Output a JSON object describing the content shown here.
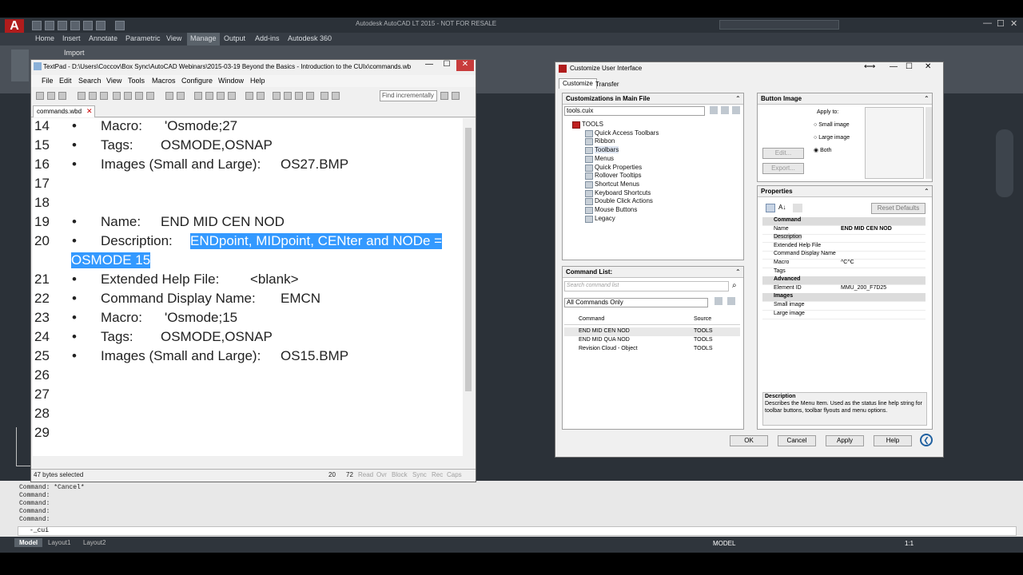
{
  "acad": {
    "title": "Autodesk AutoCAD LT 2015 - NOT FOR RESALE",
    "ribbon_tabs": [
      "Home",
      "Insert",
      "Annotate",
      "Parametric",
      "View",
      "Manage",
      "Output",
      "Add-ins",
      "Autodesk 360"
    ],
    "import_label": "Import",
    "cmd_lines": [
      "Command: *Cancel*",
      "Command:",
      "Command:",
      "Command:",
      "Command:"
    ],
    "cmd_input": "-_cui",
    "layout_tabs": [
      "Model",
      "Layout1",
      "Layout2"
    ],
    "status_model": "MODEL",
    "status_scale": "1:1"
  },
  "textpad": {
    "title": "TextPad - D:\\Users\\Coccov\\Box Sync\\AutoCAD Webinars\\2015-03-19 Beyond the Basics - Introduction to the CUIx\\commands.wbd",
    "menu": [
      "File",
      "Edit",
      "Search",
      "View",
      "Tools",
      "Macros",
      "Configure",
      "Window",
      "Help"
    ],
    "search_placeholder": "Find incrementally",
    "tab": "commands.wbd",
    "lines": [
      {
        "n": "14",
        "bullet": "•",
        "label": "Macro:",
        "value": "'Osmode;27"
      },
      {
        "n": "15",
        "bullet": "•",
        "label": "Tags:",
        "value": "OSMODE,OSNAP"
      },
      {
        "n": "16",
        "bullet": "•",
        "label": "Images (Small and Large):",
        "value": "OS27.BMP"
      },
      {
        "n": "17",
        "bullet": "",
        "label": "",
        "value": ""
      },
      {
        "n": "18",
        "bullet": "",
        "label": "",
        "value": ""
      },
      {
        "n": "19",
        "bullet": "•",
        "label": "Name:",
        "value": "END MID CEN NOD"
      },
      {
        "n": "20",
        "bullet": "•",
        "label": "Description:",
        "value": "ENDpoint, MIDpoint, CENter and NODe ="
      },
      {
        "n": "",
        "bullet": "",
        "label": "",
        "value": "OSMODE 15"
      },
      {
        "n": "21",
        "bullet": "•",
        "label": "Extended Help File:",
        "value": "<blank>"
      },
      {
        "n": "22",
        "bullet": "•",
        "label": "Command Display Name:",
        "value": "EMCN"
      },
      {
        "n": "23",
        "bullet": "•",
        "label": "Macro:",
        "value": "'Osmode;15"
      },
      {
        "n": "24",
        "bullet": "•",
        "label": "Tags:",
        "value": "OSMODE,OSNAP"
      },
      {
        "n": "25",
        "bullet": "•",
        "label": "Images (Small and Large):",
        "value": "OS15.BMP"
      },
      {
        "n": "26",
        "bullet": "",
        "label": "",
        "value": ""
      },
      {
        "n": "27",
        "bullet": "",
        "label": "",
        "value": ""
      },
      {
        "n": "28",
        "bullet": "",
        "label": "",
        "value": ""
      },
      {
        "n": "29",
        "bullet": "",
        "label": "",
        "value": ""
      }
    ],
    "status": {
      "selected": "47 bytes selected",
      "line": "20",
      "col": "72",
      "flags": [
        "Read",
        "Ovr",
        "Block",
        "Sync",
        "Rec",
        "Caps"
      ]
    }
  },
  "cui": {
    "title": "Customize User Interface",
    "tabs": [
      "Customize",
      "Transfer"
    ],
    "customizations_header": "Customizations in Main File",
    "file_select": "tools.cuix",
    "tree": [
      "TOOLS",
      "Quick Access Toolbars",
      "Ribbon",
      "Toolbars",
      "Menus",
      "Quick Properties",
      "Rollover Tooltips",
      "Shortcut Menus",
      "Keyboard Shortcuts",
      "Double Click Actions",
      "Mouse Buttons",
      "Legacy"
    ],
    "command_list_header": "Command List:",
    "search_placeholder": "Search command list",
    "filter": "All Commands Only",
    "cmd_cols": [
      "Command",
      "Source"
    ],
    "commands": [
      {
        "name": "END MID CEN NOD",
        "source": "TOOLS"
      },
      {
        "name": "END MID QUA NOD",
        "source": "TOOLS"
      },
      {
        "name": "Revision Cloud - Object",
        "source": "TOOLS"
      }
    ],
    "button_image_header": "Button Image",
    "apply_to": "Apply to:",
    "radio": [
      "Small image",
      "Large image",
      "Both"
    ],
    "edit_btn": "Edit...",
    "export_btn": "Export...",
    "properties_header": "Properties",
    "reset_defaults": "Reset Defaults",
    "props": [
      {
        "k": "Command",
        "v": "",
        "cat": true
      },
      {
        "k": "Name",
        "v": "END MID CEN NOD",
        "cat": false
      },
      {
        "k": "Description",
        "v": "",
        "cat": false
      },
      {
        "k": "Extended Help File",
        "v": "",
        "cat": false
      },
      {
        "k": "Command Display Name",
        "v": "",
        "cat": false
      },
      {
        "k": "Macro",
        "v": "^C^C",
        "cat": false
      },
      {
        "k": "Tags",
        "v": "",
        "cat": false
      },
      {
        "k": "Advanced",
        "v": "",
        "cat": true
      },
      {
        "k": "Element ID",
        "v": "MMU_200_F7D25",
        "cat": false
      },
      {
        "k": "Images",
        "v": "",
        "cat": true
      },
      {
        "k": "Small image",
        "v": "",
        "cat": false
      },
      {
        "k": "Large image",
        "v": "",
        "cat": false
      }
    ],
    "desc_title": "Description",
    "desc_text": "Describes the Menu Item. Used as the status line help string for toolbar buttons, toolbar flyouts and menu options.",
    "buttons": [
      "OK",
      "Cancel",
      "Apply",
      "Help"
    ]
  },
  "colors": {
    "highlight": "#3399ff",
    "acad_dark": "#2b3138"
  }
}
